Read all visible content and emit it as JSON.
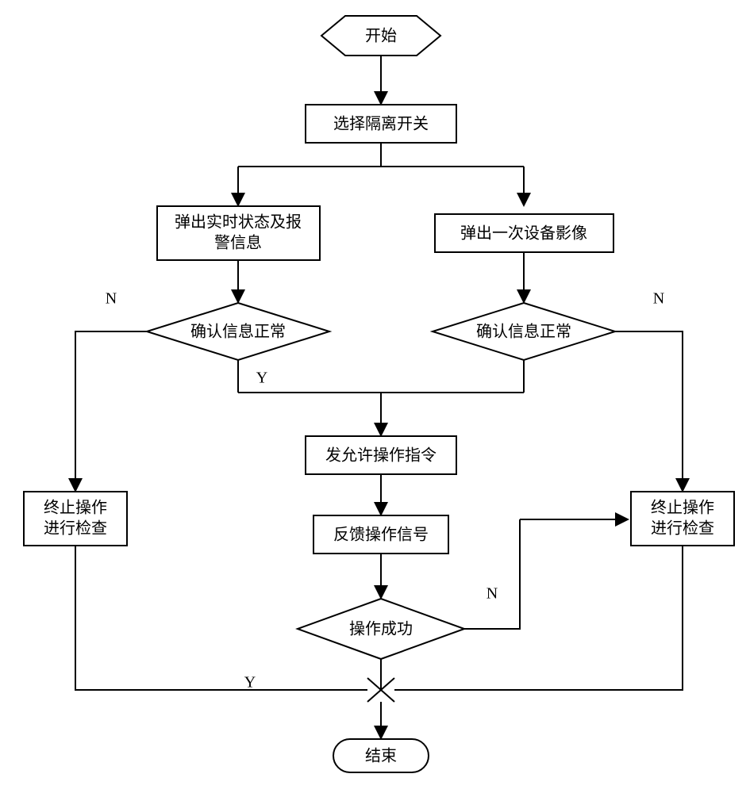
{
  "nodes": {
    "start": "开始",
    "select": "选择隔离开关",
    "left_popup_l1": "弹出实时状态及报",
    "left_popup_l2": "警信息",
    "right_popup": "弹出一次设备影像",
    "left_confirm": "确认信息正常",
    "right_confirm": "确认信息正常",
    "send_cmd": "发允许操作指令",
    "feedback": "反馈操作信号",
    "success": "操作成功",
    "left_abort_l1": "终止操作",
    "left_abort_l2": "进行检查",
    "right_abort_l1": "终止操作",
    "right_abort_l2": "进行检查",
    "end": "结束"
  },
  "labels": {
    "Y": "Y",
    "N": "N"
  }
}
